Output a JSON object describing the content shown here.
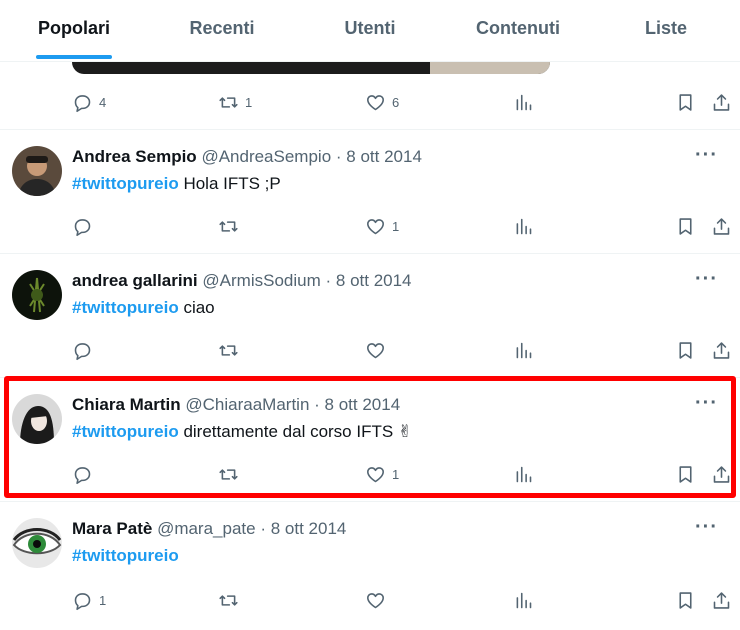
{
  "tabs": [
    {
      "label": "Popolari",
      "active": true
    },
    {
      "label": "Recenti"
    },
    {
      "label": "Utenti"
    },
    {
      "label": "Contenuti"
    },
    {
      "label": "Liste"
    }
  ],
  "top_partial": {
    "reply_count": "4",
    "retweet_count": "1",
    "like_count": "6"
  },
  "tweets": [
    {
      "name": "Andrea Sempio",
      "handle": "@AndreaSempio",
      "date": "8 ott 2014",
      "hashtag": "#twittopureio",
      "text": " Hola IFTS ;P",
      "reply_count": "",
      "retweet_count": "",
      "like_count": "1"
    },
    {
      "name": "andrea gallarini",
      "handle": "@ArmisSodium",
      "date": "8 ott 2014",
      "hashtag": "#twittopureio",
      "text": " ciao",
      "reply_count": "",
      "retweet_count": "",
      "like_count": ""
    },
    {
      "name": "Chiara Martin",
      "handle": "@ChiaraaMartin",
      "date": "8 ott 2014",
      "hashtag": "#twittopureio",
      "text": " direttamente dal corso IFTS ✌",
      "reply_count": "",
      "retweet_count": "",
      "like_count": "1"
    },
    {
      "name": "Mara Patè",
      "handle": "@mara_pate",
      "date": "8 ott 2014",
      "hashtag": "#twittopureio",
      "text": "",
      "reply_count": "1",
      "retweet_count": "",
      "like_count": ""
    }
  ],
  "separator": "·",
  "more_glyph": "···",
  "colors": {
    "accent": "#1d9bf0",
    "highlight": "#ff0000",
    "muted": "#536471"
  },
  "icons": [
    "reply-icon",
    "retweet-icon",
    "like-icon",
    "views-icon",
    "bookmark-icon",
    "share-icon",
    "more-icon"
  ]
}
